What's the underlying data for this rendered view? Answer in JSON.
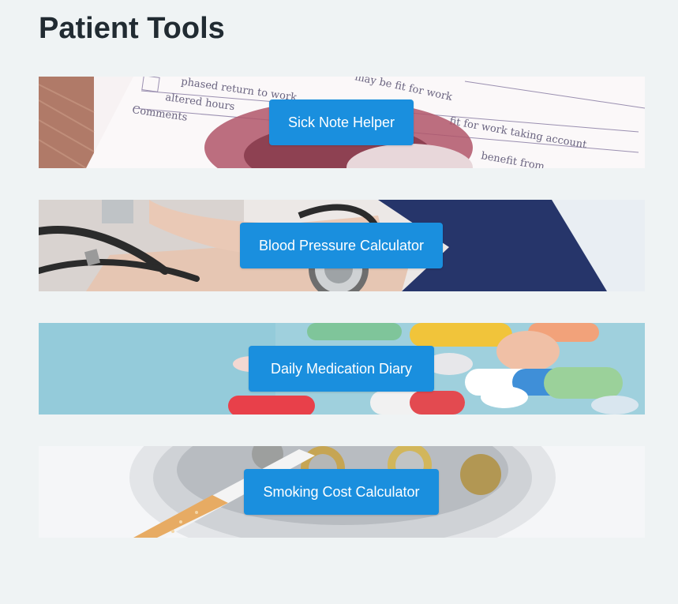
{
  "page": {
    "title": "Patient Tools"
  },
  "tools": [
    {
      "label": "Sick Note Helper",
      "image": "sick-note-form-image"
    },
    {
      "label": "Blood Pressure Calculator",
      "image": "blood-pressure-cuff-image"
    },
    {
      "label": "Daily Medication Diary",
      "image": "pills-capsules-image"
    },
    {
      "label": "Smoking Cost Calculator",
      "image": "cigarette-coins-ashtray-image"
    }
  ],
  "colors": {
    "background": "#eff3f4",
    "title_text": "#212b32",
    "button_bg": "#1a8fde",
    "button_text": "#ffffff"
  }
}
